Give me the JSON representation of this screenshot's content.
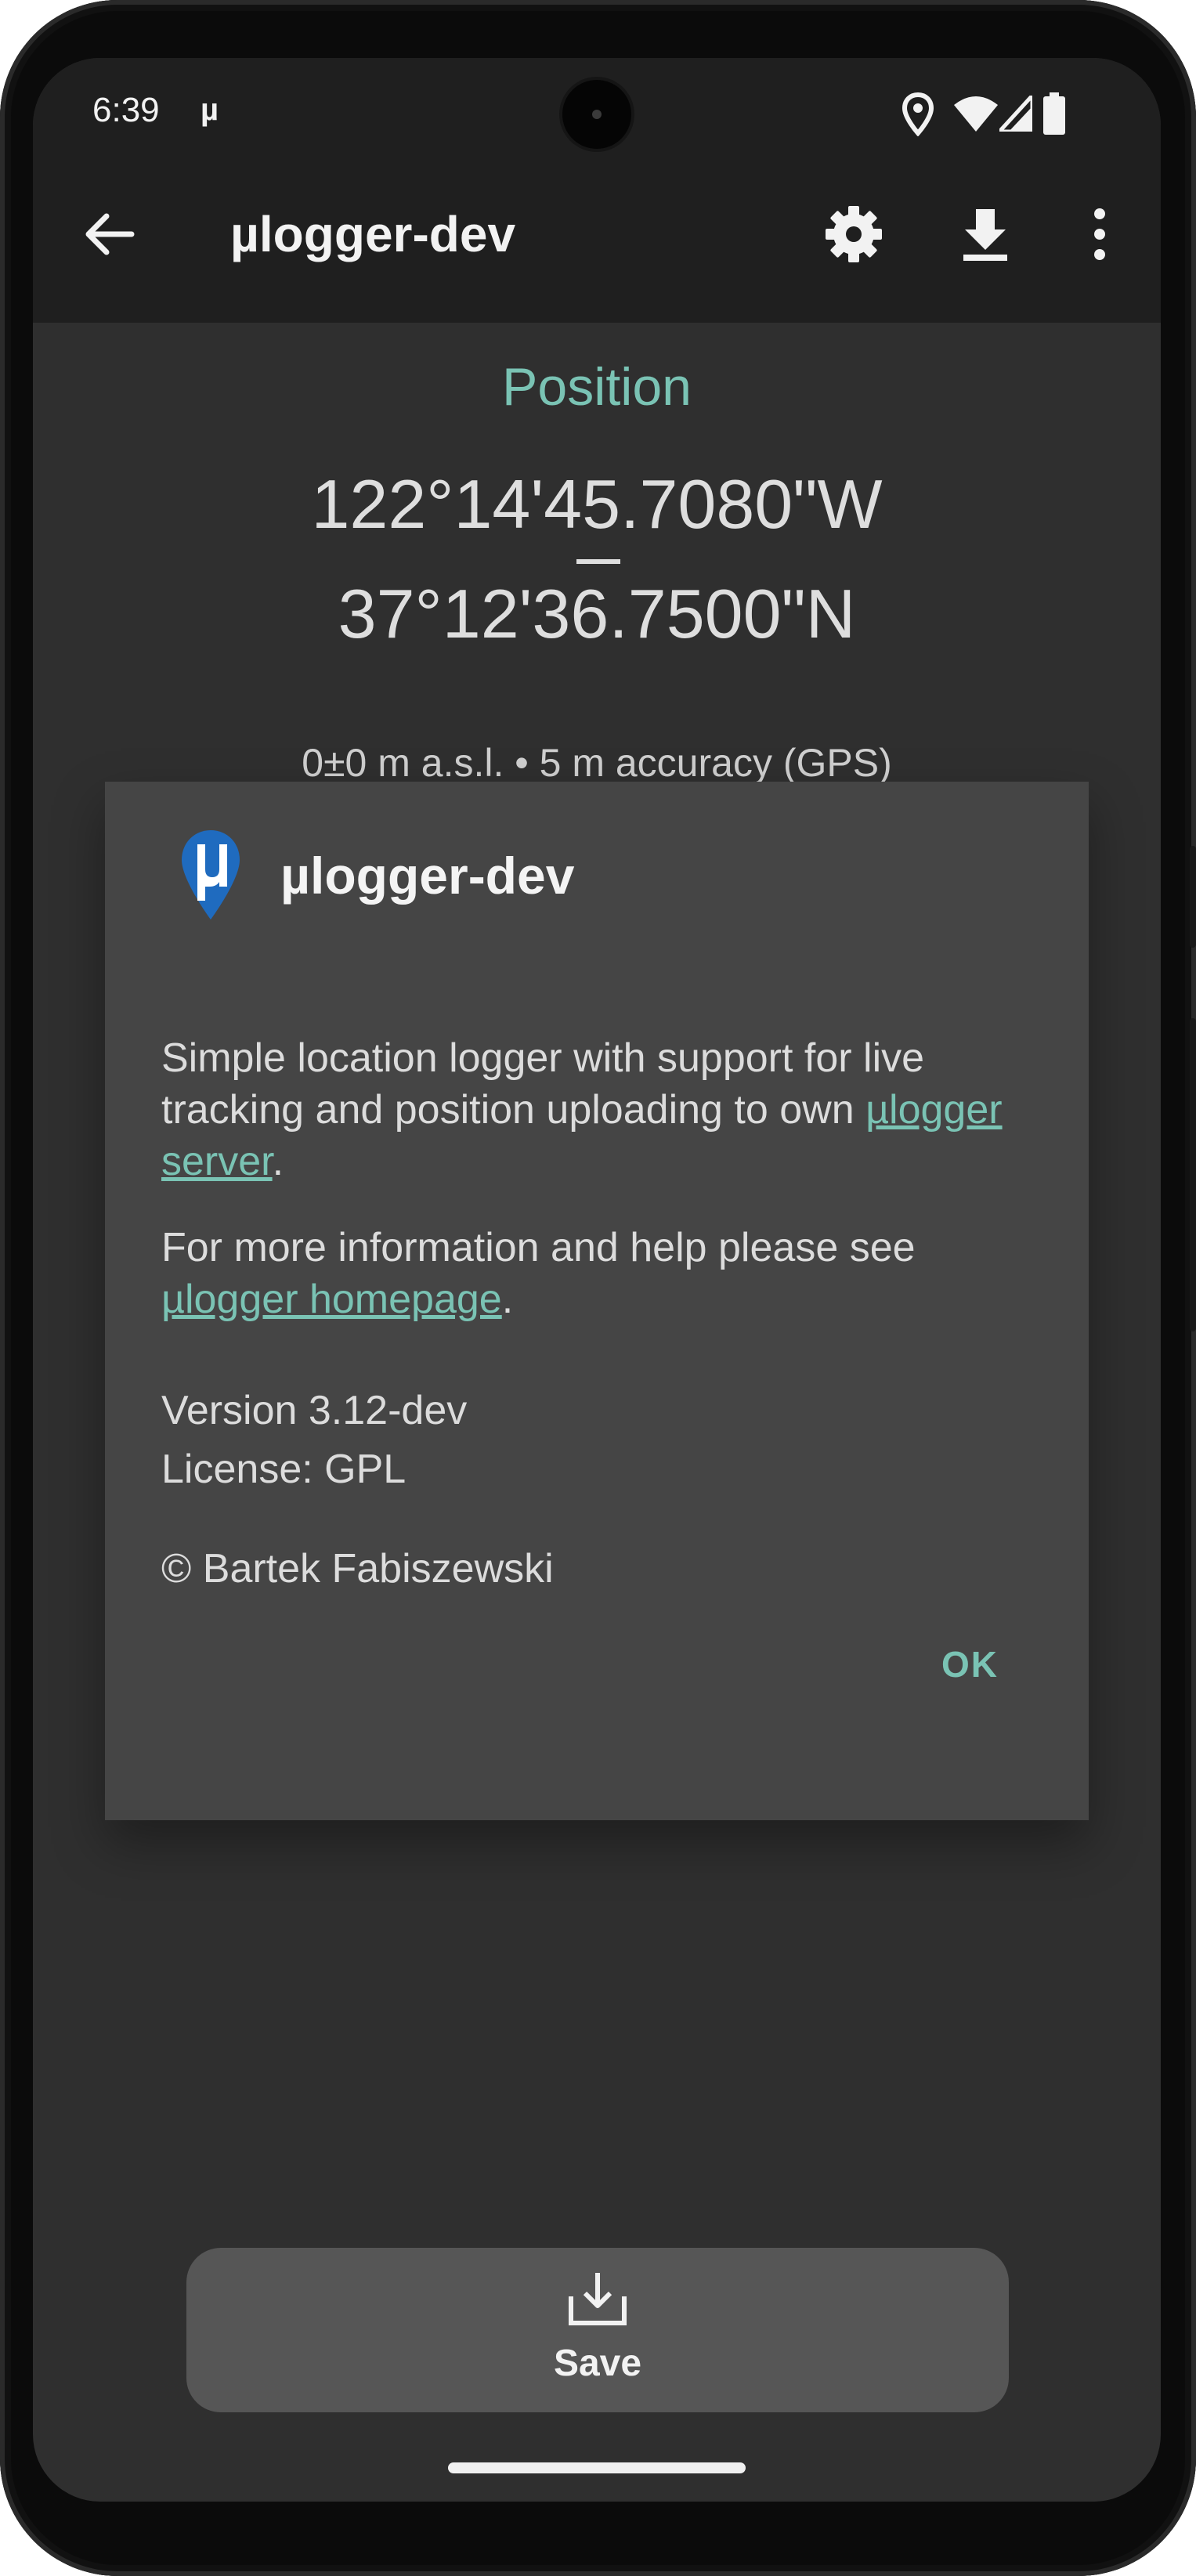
{
  "status_bar": {
    "time": "6:39",
    "notification_glyph": "µ",
    "icons": [
      "location-icon",
      "wifi-icon",
      "signal-icon",
      "battery-icon"
    ]
  },
  "app_bar": {
    "title": "µlogger-dev",
    "back_icon": "arrow-back-icon",
    "actions": [
      "settings-icon",
      "download-icon",
      "more-vert-icon"
    ]
  },
  "position": {
    "title": "Position",
    "longitude": "122°14'45.7080\"W",
    "latitude": "37°12'36.7500\"N",
    "details": "0±0 m a.s.l. • 5 m accuracy (GPS)"
  },
  "about_dialog": {
    "title": "µlogger-dev",
    "description_prefix": "Simple location logger with support for live tracking and position uploading to own ",
    "server_link": "µlogger server",
    "description_suffix": ".",
    "info_prefix": "For more information and help please see ",
    "homepage_link": "µlogger homepage",
    "info_suffix": ".",
    "version": "Version 3.12-dev",
    "license": "License: GPL",
    "copyright": "© Bartek Fabiszewski",
    "ok_label": "OK"
  },
  "save_button": {
    "label": "Save",
    "icon": "save-download-icon"
  },
  "colors": {
    "accent": "#7ac3b4",
    "background": "#2f2f2f",
    "app_bar": "#1f1f1f",
    "dialog": "#454545",
    "logo_blue": "#1f6bbf"
  }
}
